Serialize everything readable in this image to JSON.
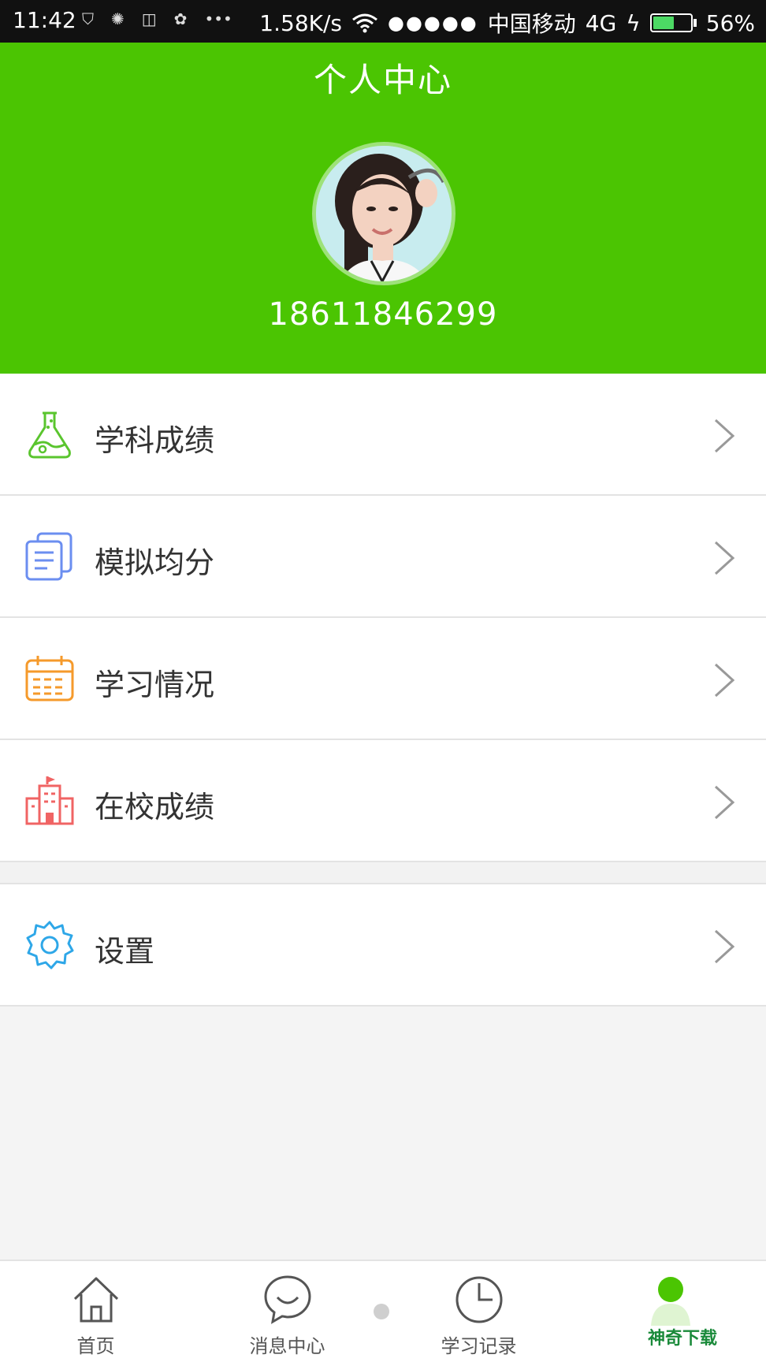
{
  "status_bar": {
    "time": "11:42",
    "network_speed": "1.58K/s",
    "carrier": "中国移动",
    "network_type": "4G",
    "battery_percent": "56%",
    "battery_level": 0.56,
    "signal_dots": "●●●●●"
  },
  "header": {
    "title": "个人中心",
    "phone": "18611846299"
  },
  "menu": {
    "items": [
      {
        "label": "学科成绩",
        "icon": "flask-icon",
        "color": "#5ac52e"
      },
      {
        "label": "模拟均分",
        "icon": "documents-icon",
        "color": "#6b8ef0"
      },
      {
        "label": "学习情况",
        "icon": "calendar-icon",
        "color": "#f59a2b"
      },
      {
        "label": "在校成绩",
        "icon": "school-building-icon",
        "color": "#f06464"
      }
    ],
    "settings": {
      "label": "设置",
      "icon": "gear-icon",
      "color": "#2ea7e8"
    }
  },
  "tabbar": {
    "tabs": [
      {
        "label": "首页",
        "icon": "home-icon"
      },
      {
        "label": "消息中心",
        "icon": "chat-bubble-icon"
      },
      {
        "label": "学习记录",
        "icon": "clock-icon"
      },
      {
        "label": "",
        "icon": "profile-icon"
      }
    ],
    "watermark": "神奇下载"
  },
  "colors": {
    "brand_green": "#4bc502",
    "status_bar": "#111111",
    "background": "#f4f4f4"
  }
}
